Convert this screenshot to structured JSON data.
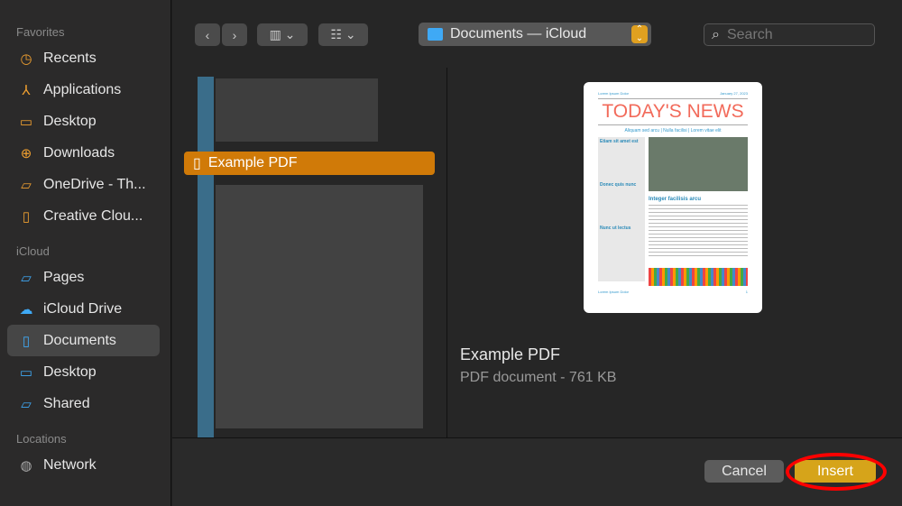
{
  "sidebar": {
    "sections": [
      {
        "title": "Favorites",
        "items": [
          {
            "label": "Recents",
            "icon": "clock-icon"
          },
          {
            "label": "Applications",
            "icon": "applications-icon"
          },
          {
            "label": "Desktop",
            "icon": "desktop-icon"
          },
          {
            "label": "Downloads",
            "icon": "download-icon"
          },
          {
            "label": "OneDrive - Th...",
            "icon": "folder-icon"
          },
          {
            "label": "Creative Clou...",
            "icon": "document-icon"
          }
        ]
      },
      {
        "title": "iCloud",
        "items": [
          {
            "label": "Pages",
            "icon": "folder-icon"
          },
          {
            "label": "iCloud Drive",
            "icon": "cloud-icon"
          },
          {
            "label": "Documents",
            "icon": "document-icon",
            "selected": true
          },
          {
            "label": "Desktop",
            "icon": "desktop-icon"
          },
          {
            "label": "Shared",
            "icon": "shared-folder-icon"
          }
        ]
      },
      {
        "title": "Locations",
        "items": [
          {
            "label": "Network",
            "icon": "globe-icon"
          }
        ]
      }
    ]
  },
  "toolbar": {
    "location": "Documents — iCloud",
    "search_placeholder": "Search"
  },
  "browser": {
    "selected_file": "Example PDF"
  },
  "preview": {
    "name": "Example PDF",
    "meta": "PDF document - 761 KB",
    "thumb": {
      "top_left": "Lorem Ipsum Dolor",
      "date": "January 27, 2023",
      "title": "TODAY'S NEWS",
      "subtitle": "Aliquam sed arcu | Nulla facilisi | Lorem vitae elit",
      "side_heads": [
        "Etiam sit amet est",
        "Donec quis nunc",
        "Nunc ut lectus"
      ],
      "main_head": "Integer facilisis arcu",
      "footer": "Lorem Ipsum Dolor",
      "page": "1"
    }
  },
  "actions": {
    "cancel": "Cancel",
    "insert": "Insert"
  },
  "colors": {
    "accent": "#d07a08",
    "insert": "#d6a41a",
    "highlight_ring": "#ff0000"
  }
}
